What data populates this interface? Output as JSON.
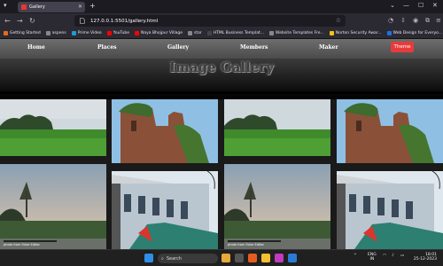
{
  "browser": {
    "tab_title": "Gallery",
    "url": "127.0.0.1:5501/gallery.html",
    "bookmarks": [
      {
        "label": "Getting Started",
        "color": "#e66a1e"
      },
      {
        "label": "aspens",
        "color": "#888888"
      },
      {
        "label": "Prime Video",
        "color": "#1b9bd7"
      },
      {
        "label": "YouTube",
        "color": "#ff0000"
      },
      {
        "label": "Naya Bhojpur Village",
        "color": "#ff0000"
      },
      {
        "label": "star",
        "color": "#888888"
      },
      {
        "label": "HTML Business Templat...",
        "color": "#444444"
      },
      {
        "label": "Website Templates Fre...",
        "color": "#888888"
      },
      {
        "label": "Norton Security Awar...",
        "color": "#f6c20e"
      },
      {
        "label": "Web Design for Everyo...",
        "color": "#1a73e8"
      }
    ]
  },
  "site": {
    "nav": [
      "Home",
      "Places",
      "Gallery",
      "Members",
      "Maker"
    ],
    "theme_button": "Theme",
    "title": "Image Gallery",
    "photo_caption": "photo from Fotor Editor"
  },
  "taskbar": {
    "search": "Search",
    "lang": "ENG",
    "lang_sub": "IN",
    "time": "18:01",
    "date": "25-12-2023"
  }
}
